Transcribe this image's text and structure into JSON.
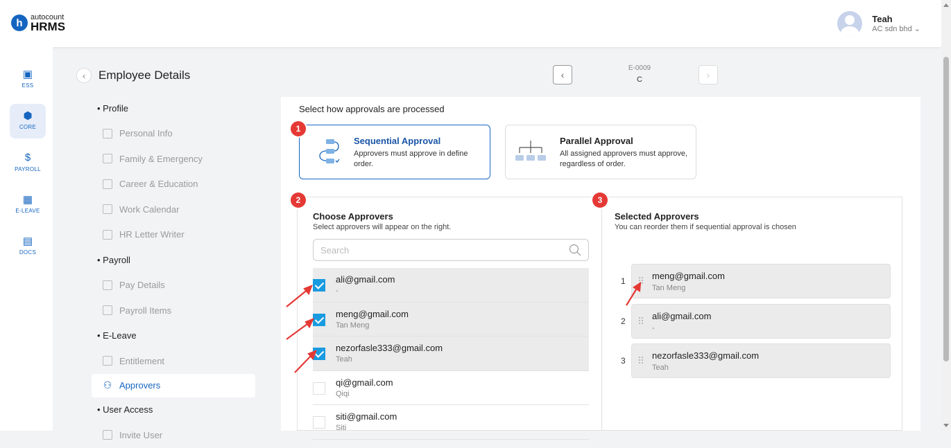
{
  "brand": {
    "logo_letter": "h",
    "top": "autocount",
    "bottom": "HRMS"
  },
  "user": {
    "name": "Teah",
    "company": "AC sdn bhd",
    "caret": "⌄"
  },
  "leftnav": [
    {
      "label": "ESS",
      "icon": "ess-icon",
      "glyph": "▣"
    },
    {
      "label": "CORE",
      "icon": "core-icon",
      "glyph": "⬢"
    },
    {
      "label": "PAYROLL",
      "icon": "payroll-icon",
      "glyph": "$"
    },
    {
      "label": "E-LEAVE",
      "icon": "calendar-icon",
      "glyph": "▦"
    },
    {
      "label": "DOCS",
      "icon": "docs-icon",
      "glyph": "▤"
    }
  ],
  "page": {
    "back": "‹",
    "title": "Employee Details"
  },
  "menu": {
    "profile": "Profile",
    "personal_info": "Personal Info",
    "family": "Family & Emergency",
    "career": "Career & Education",
    "work_calendar": "Work Calendar",
    "hr_letter": "HR Letter Writer",
    "payroll": "Payroll",
    "pay_details": "Pay Details",
    "payroll_items": "Payroll Items",
    "eleave": "E-Leave",
    "entitlement": "Entitlement",
    "approvers": "Approvers",
    "user_access": "User Access",
    "invite": "Invite User"
  },
  "employee": {
    "code": "E-0009",
    "name": "C",
    "prev": "‹",
    "next": "›"
  },
  "approval": {
    "instruction": "Select how approvals are processed",
    "sequential": {
      "title": "Sequential Approval",
      "desc": "Approvers must approve in define order.",
      "selected": true
    },
    "parallel": {
      "title": "Parallel Approval",
      "desc": "All assigned approvers must approve, regardless of order.",
      "selected": false
    }
  },
  "badges": {
    "b1": "1",
    "b2": "2",
    "b3": "3"
  },
  "choose": {
    "title": "Choose Approvers",
    "subtitle": "Select approvers will appear on the right.",
    "search_placeholder": "Search",
    "items": [
      {
        "email": "ali@gmail.com",
        "name": "-",
        "checked": true
      },
      {
        "email": "meng@gmail.com",
        "name": "Tan Meng",
        "checked": true
      },
      {
        "email": "nezorfasle333@gmail.com",
        "name": "Teah",
        "checked": true
      },
      {
        "email": "qi@gmail.com",
        "name": "Qiqi",
        "checked": false
      },
      {
        "email": "siti@gmail.com",
        "name": "Siti",
        "checked": false
      }
    ]
  },
  "selected": {
    "title": "Selected Approvers",
    "subtitle": "You can reorder them if sequential approval is chosen",
    "items": [
      {
        "num": "1",
        "email": "meng@gmail.com",
        "name": "Tan Meng"
      },
      {
        "num": "2",
        "email": "ali@gmail.com",
        "name": "-"
      },
      {
        "num": "3",
        "email": "nezorfasle333@gmail.com",
        "name": "Teah"
      }
    ]
  },
  "colors": {
    "brand": "#1565c0",
    "checkbox": "#1a9be0",
    "badge": "#e53935"
  }
}
